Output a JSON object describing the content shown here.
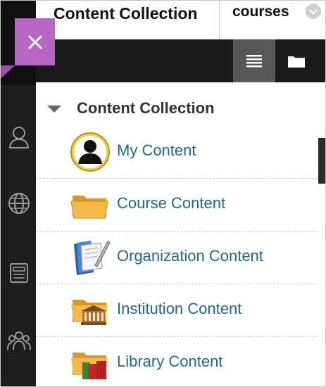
{
  "tabs": {
    "active_label": "Content Collection",
    "courses_label": "courses"
  },
  "section": {
    "title": "Content Collection"
  },
  "items": [
    {
      "label": "My Content",
      "icon": "user-avatar-icon"
    },
    {
      "label": "Course Content",
      "icon": "folder-icon"
    },
    {
      "label": "Organization Content",
      "icon": "book-pencil-icon"
    },
    {
      "label": "Institution Content",
      "icon": "institution-folder-icon"
    },
    {
      "label": "Library Content",
      "icon": "library-folder-icon"
    }
  ],
  "colors": {
    "accent": "#b767c3",
    "link": "#1a6a93",
    "rail": "#1e1e1e",
    "toolbar": "#1a1a1a"
  }
}
